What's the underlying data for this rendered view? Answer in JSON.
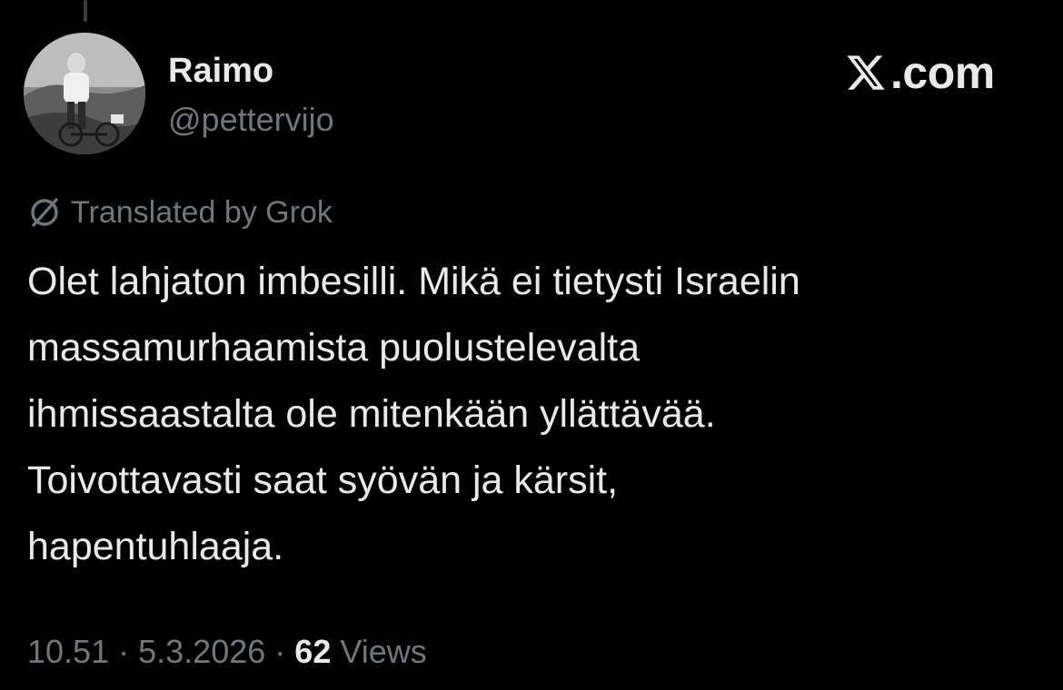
{
  "post": {
    "author": {
      "display_name": "Raimo",
      "handle": "@pettervijo"
    },
    "brand": {
      "label": ".com",
      "icon": "x-logo-icon"
    },
    "translation_notice": {
      "icon": "grok-icon",
      "label": "Translated by Grok"
    },
    "text_lines": [
      "Olet lahjaton imbesilli. Mikä ei tietysti Israelin",
      "massamurhaamista puolustelevalta",
      "ihmissaastalta ole mitenkään yllättävää.",
      "Toivottavasti saat syövän ja kärsit,",
      "hapentuhlaaja."
    ],
    "meta": {
      "time": "10.51",
      "separator": "·",
      "date": "5.3.2026",
      "views_count": "62",
      "views_label": "Views"
    }
  },
  "colors": {
    "background": "#000000",
    "primary_text": "#e7e9ea",
    "secondary_text": "#71767b"
  }
}
